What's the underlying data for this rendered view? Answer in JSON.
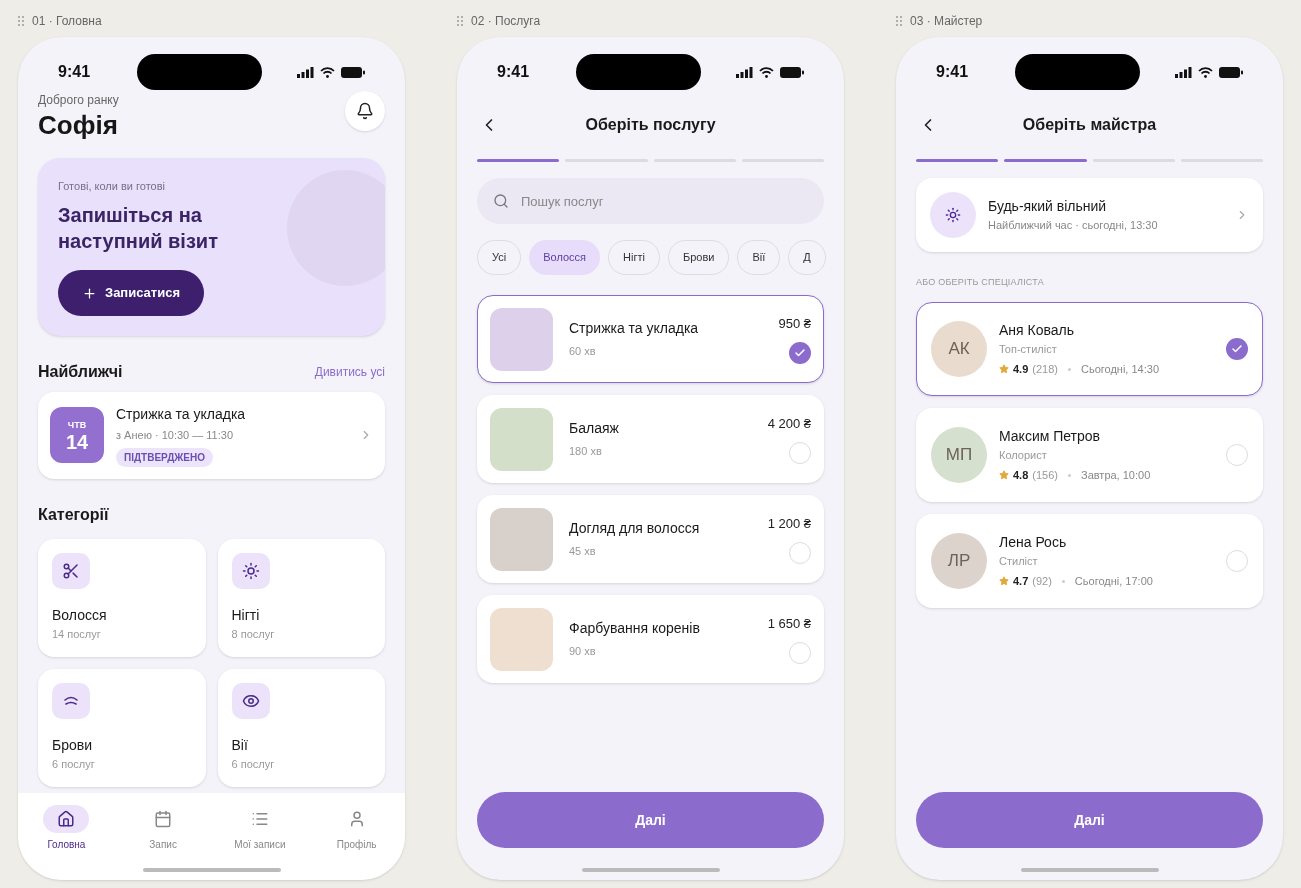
{
  "screens": [
    {
      "kind": "home",
      "frame_label": "01 · Головна",
      "status_time": "9:41",
      "greeting": "Доброго ранку",
      "name": "Софія",
      "hero": {
        "subtitle": "Готові, коли ви готові",
        "title": "Запишіться на наступний візит",
        "button": "Записатися"
      },
      "upcoming": {
        "title": "Найближчі",
        "link": "Дивитись усі",
        "appointment": {
          "weekday": "ЧТВ",
          "day": "14",
          "title": "Стрижка та укладка",
          "details": "з Анею · 10:30 — 11:30",
          "badge": "ПІДТВЕРДЖЕНО"
        }
      },
      "categories": {
        "title": "Категорії",
        "items": [
          {
            "name": "Волосся",
            "count": "14 послуг"
          },
          {
            "name": "Нігті",
            "count": "8 послуг"
          },
          {
            "name": "Брови",
            "count": "6 послуг"
          },
          {
            "name": "Вії",
            "count": "6 послуг"
          }
        ]
      },
      "tabs": [
        {
          "label": "Головна",
          "selected": true
        },
        {
          "label": "Запис",
          "selected": false
        },
        {
          "label": "Мої записи",
          "selected": false
        },
        {
          "label": "Профіль",
          "selected": false
        }
      ]
    },
    {
      "kind": "service",
      "frame_label": "02 · Послуга",
      "status_time": "9:41",
      "title": "Оберіть послугу",
      "steps": [
        {
          "done": true
        },
        {
          "done": false
        },
        {
          "done": false
        },
        {
          "done": false
        }
      ],
      "search": {
        "placeholder": "Пошук послуг"
      },
      "chips": [
        {
          "label": "Усі",
          "selected": false
        },
        {
          "label": "Волосся",
          "selected": true
        },
        {
          "label": "Нігті",
          "selected": false
        },
        {
          "label": "Брови",
          "selected": false
        },
        {
          "label": "Вії",
          "selected": false
        },
        {
          "label": "Д",
          "selected": false
        }
      ],
      "services": [
        {
          "name": "Стрижка та укладка",
          "duration": "60 хв",
          "price": "950 ₴",
          "selected": true,
          "color": "#ddd0ea"
        },
        {
          "name": "Балаяж",
          "duration": "180 хв",
          "price": "4 200 ₴",
          "selected": false,
          "color": "#d3dfc9"
        },
        {
          "name": "Догляд для волосся",
          "duration": "45 хв",
          "price": "1 200 ₴",
          "selected": false,
          "color": "#d8d0ca"
        },
        {
          "name": "Фарбування коренів",
          "duration": "90 хв",
          "price": "1 650 ₴",
          "selected": false,
          "color": "#eedfd0"
        }
      ],
      "button": "Далі"
    },
    {
      "kind": "master",
      "frame_label": "03 · Майстер",
      "status_time": "9:41",
      "title": "Оберіть майстра",
      "steps": [
        {
          "done": true
        },
        {
          "done": true
        },
        {
          "done": false
        },
        {
          "done": false
        }
      ],
      "any": {
        "title": "Будь-який вільний",
        "subtitle": "Найближчий час · сьогодні, 13:30"
      },
      "section_label": "АБО ОБЕРІТЬ СПЕЦІАЛІСТА",
      "masters": [
        {
          "initials": "АК",
          "name": "Аня Коваль",
          "role": "Топ-стиліст",
          "rating": "4.9",
          "reviews": "(218)",
          "next": "Сьогодні, 14:30",
          "selected": true,
          "color": "#eadbcf"
        },
        {
          "initials": "МП",
          "name": "Максим Петров",
          "role": "Колорист",
          "rating": "4.8",
          "reviews": "(156)",
          "next": "Завтра, 10:00",
          "selected": false,
          "color": "#d6e0cf"
        },
        {
          "initials": "ЛР",
          "name": "Лена Рось",
          "role": "Стиліст",
          "rating": "4.7",
          "reviews": "(92)",
          "next": "Сьогодні, 17:00",
          "selected": false,
          "color": "#ddd3cd"
        }
      ],
      "button": "Далі"
    }
  ]
}
